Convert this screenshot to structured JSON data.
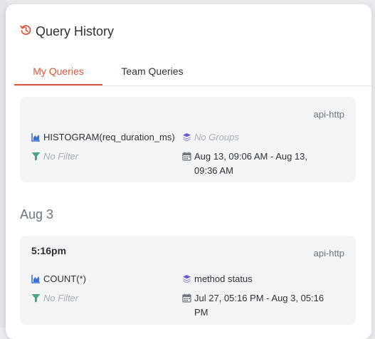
{
  "panel": {
    "title": "Query History",
    "tabs": [
      {
        "label": "My Queries",
        "active": true
      },
      {
        "label": "Team Queries",
        "active": false
      }
    ]
  },
  "colors": {
    "accent": "#e0573c",
    "viz_icon": "#3b6fd8",
    "groups_icon": "#6e58c9",
    "filter_icon": "#4aa58a",
    "calendar_icon": "#6c7580"
  },
  "icons": {
    "history": "history-icon",
    "visualize": "chart-icon",
    "group_by": "layers-icon",
    "filter": "filter-icon",
    "time_range": "calendar-icon"
  },
  "entries": [
    {
      "time": "",
      "dataset": "api-http",
      "visualize": "HISTOGRAM(req_duration_ms)",
      "group_by": "No Groups",
      "filter": "No Filter",
      "time_range": "Aug 13, 09:06 AM - Aug 13, 09:36 AM"
    },
    {
      "date_header": "Aug 3",
      "time": "5:16pm",
      "dataset": "api-http",
      "visualize": "COUNT(*)",
      "group_by": "method status",
      "filter": "No Filter",
      "time_range": "Jul 27, 05:16 PM - Aug 3, 05:16 PM"
    }
  ]
}
